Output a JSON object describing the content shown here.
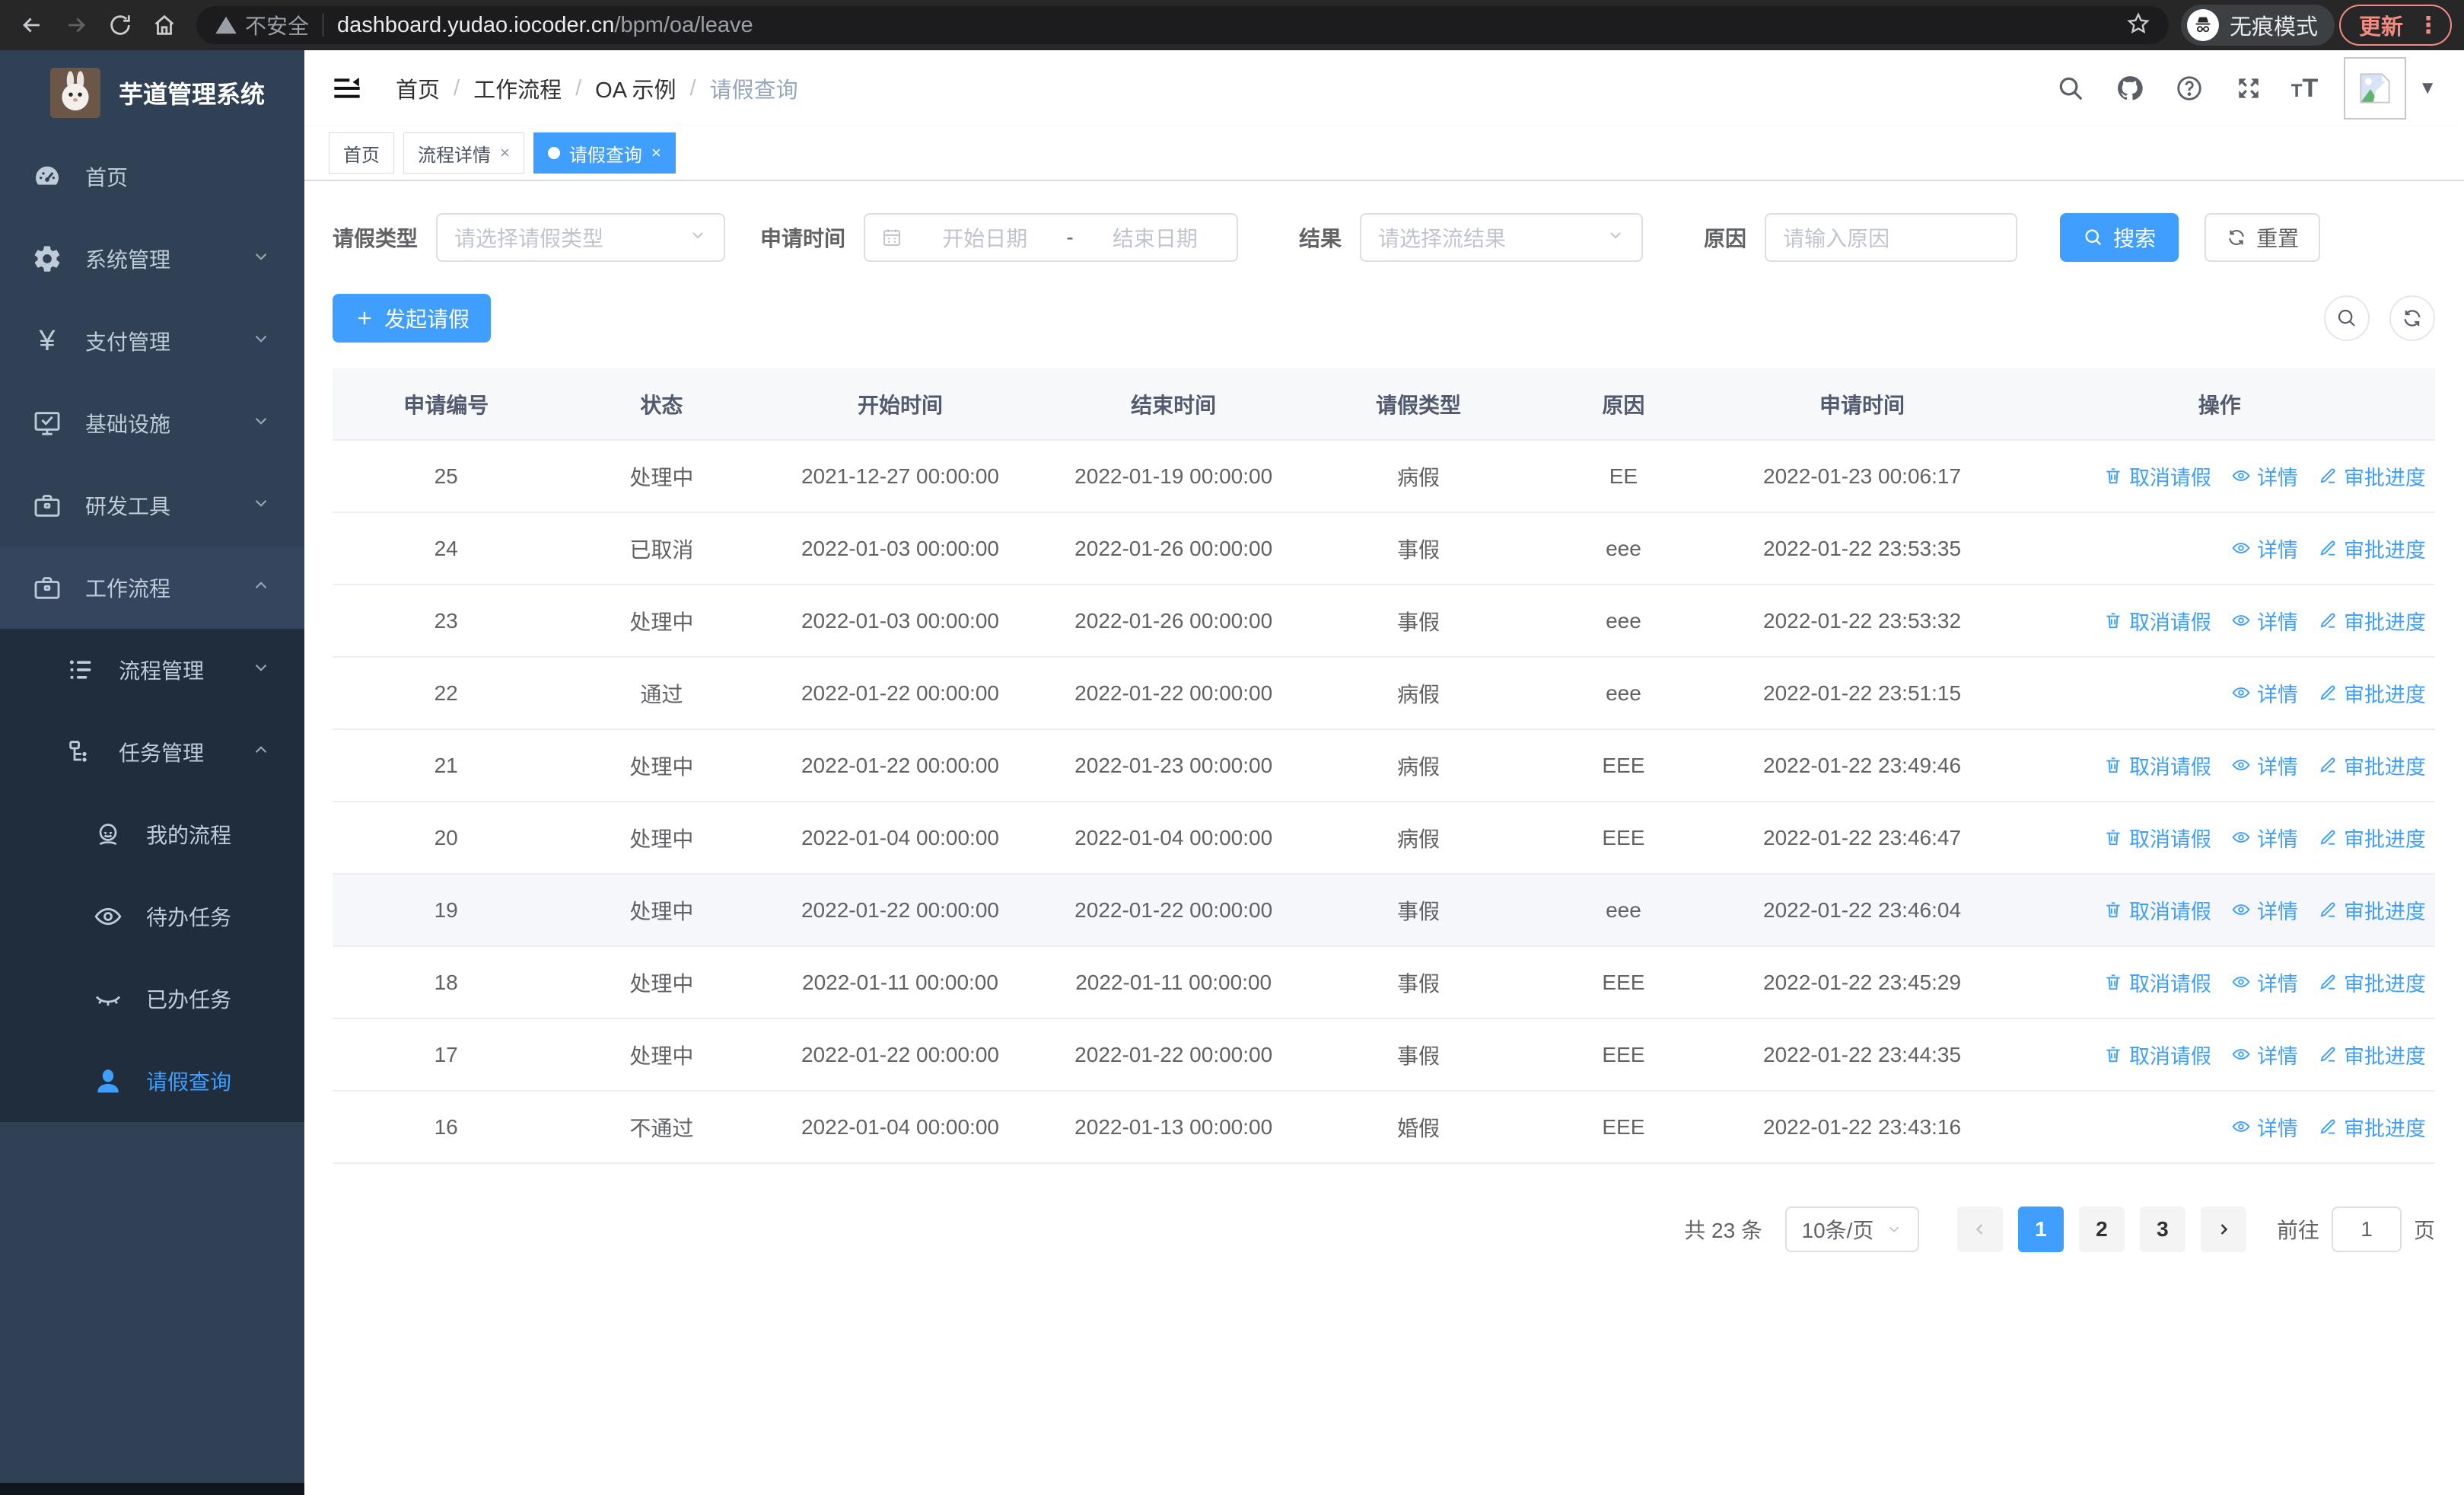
{
  "colors": {
    "accent": "#409eff",
    "update_button": "#f28b82",
    "sidebar_bg": "#304156",
    "submenu_bg": "#1f2d3d"
  },
  "browser": {
    "security_label": "不安全",
    "url_domain": "dashboard.yudao.iocoder.cn",
    "url_path": "/bpm/oa/leave",
    "incognito_label": "无痕模式",
    "update_label": "更新"
  },
  "sidebar": {
    "title": "芋道管理系统",
    "menu": [
      {
        "name": "home",
        "label": "首页",
        "icon": "dashboard-icon",
        "level": 1
      },
      {
        "name": "system",
        "label": "系统管理",
        "icon": "gear-icon",
        "level": 1,
        "chevron": "down"
      },
      {
        "name": "payment",
        "label": "支付管理",
        "icon": "yen-icon",
        "level": 1,
        "chevron": "down"
      },
      {
        "name": "infra",
        "label": "基础设施",
        "icon": "monitor-icon",
        "level": 1,
        "chevron": "down"
      },
      {
        "name": "dev-tools",
        "label": "研发工具",
        "icon": "briefcase-icon",
        "level": 1,
        "chevron": "down"
      },
      {
        "name": "workflow",
        "label": "工作流程",
        "icon": "briefcase-icon",
        "level": 1,
        "chevron": "up",
        "open": true
      },
      {
        "name": "process-mgmt",
        "label": "流程管理",
        "icon": "list-icon",
        "level": 2,
        "chevron": "down"
      },
      {
        "name": "task-mgmt",
        "label": "任务管理",
        "icon": "tree-icon",
        "level": 2,
        "chevron": "up"
      },
      {
        "name": "my-process",
        "label": "我的流程",
        "icon": "face-icon",
        "level": 3
      },
      {
        "name": "todo-task",
        "label": "待办任务",
        "icon": "eye-open-icon",
        "level": 3
      },
      {
        "name": "done-task",
        "label": "已办任务",
        "icon": "eye-closed-icon",
        "level": 3
      },
      {
        "name": "leave-query",
        "label": "请假查询",
        "icon": "user-icon",
        "level": 3,
        "active": true
      }
    ]
  },
  "breadcrumb": {
    "items": [
      "首页",
      "工作流程",
      "OA 示例",
      "请假查询"
    ],
    "separator": "/"
  },
  "tabs": [
    {
      "label": "首页",
      "closable": false,
      "active": false
    },
    {
      "label": "流程详情",
      "closable": true,
      "active": false
    },
    {
      "label": "请假查询",
      "closable": true,
      "active": true
    }
  ],
  "filters": {
    "leave_type": {
      "label": "请假类型",
      "placeholder": "请选择请假类型"
    },
    "apply_time": {
      "label": "申请时间",
      "start_placeholder": "开始日期",
      "separator": "-",
      "end_placeholder": "结束日期"
    },
    "result": {
      "label": "结果",
      "placeholder": "请选择流结果"
    },
    "reason": {
      "label": "原因",
      "placeholder": "请输入原因"
    },
    "search_label": "搜索",
    "reset_label": "重置"
  },
  "toolbar": {
    "create_label": "发起请假"
  },
  "table": {
    "columns": [
      "申请编号",
      "状态",
      "开始时间",
      "结束时间",
      "请假类型",
      "原因",
      "申请时间",
      "操作"
    ],
    "action_labels": {
      "cancel": "取消请假",
      "detail": "详情",
      "progress": "审批进度"
    },
    "rows": [
      {
        "id": "25",
        "status": "处理中",
        "start": "2021-12-27 00:00:00",
        "end": "2022-01-19 00:00:00",
        "type": "病假",
        "reason": "EE",
        "applied": "2022-01-23 00:06:17",
        "actions": [
          "cancel",
          "detail",
          "progress"
        ],
        "highlight": false
      },
      {
        "id": "24",
        "status": "已取消",
        "start": "2022-01-03 00:00:00",
        "end": "2022-01-26 00:00:00",
        "type": "事假",
        "reason": "eee",
        "applied": "2022-01-22 23:53:35",
        "actions": [
          "detail",
          "progress"
        ],
        "highlight": false
      },
      {
        "id": "23",
        "status": "处理中",
        "start": "2022-01-03 00:00:00",
        "end": "2022-01-26 00:00:00",
        "type": "事假",
        "reason": "eee",
        "applied": "2022-01-22 23:53:32",
        "actions": [
          "cancel",
          "detail",
          "progress"
        ],
        "highlight": false
      },
      {
        "id": "22",
        "status": "通过",
        "start": "2022-01-22 00:00:00",
        "end": "2022-01-22 00:00:00",
        "type": "病假",
        "reason": "eee",
        "applied": "2022-01-22 23:51:15",
        "actions": [
          "detail",
          "progress"
        ],
        "highlight": false
      },
      {
        "id": "21",
        "status": "处理中",
        "start": "2022-01-22 00:00:00",
        "end": "2022-01-23 00:00:00",
        "type": "病假",
        "reason": "EEE",
        "applied": "2022-01-22 23:49:46",
        "actions": [
          "cancel",
          "detail",
          "progress"
        ],
        "highlight": false
      },
      {
        "id": "20",
        "status": "处理中",
        "start": "2022-01-04 00:00:00",
        "end": "2022-01-04 00:00:00",
        "type": "病假",
        "reason": "EEE",
        "applied": "2022-01-22 23:46:47",
        "actions": [
          "cancel",
          "detail",
          "progress"
        ],
        "highlight": false
      },
      {
        "id": "19",
        "status": "处理中",
        "start": "2022-01-22 00:00:00",
        "end": "2022-01-22 00:00:00",
        "type": "事假",
        "reason": "eee",
        "applied": "2022-01-22 23:46:04",
        "actions": [
          "cancel",
          "detail",
          "progress"
        ],
        "highlight": true
      },
      {
        "id": "18",
        "status": "处理中",
        "start": "2022-01-11 00:00:00",
        "end": "2022-01-11 00:00:00",
        "type": "事假",
        "reason": "EEE",
        "applied": "2022-01-22 23:45:29",
        "actions": [
          "cancel",
          "detail",
          "progress"
        ],
        "highlight": false
      },
      {
        "id": "17",
        "status": "处理中",
        "start": "2022-01-22 00:00:00",
        "end": "2022-01-22 00:00:00",
        "type": "事假",
        "reason": "EEE",
        "applied": "2022-01-22 23:44:35",
        "actions": [
          "cancel",
          "detail",
          "progress"
        ],
        "highlight": false
      },
      {
        "id": "16",
        "status": "不通过",
        "start": "2022-01-04 00:00:00",
        "end": "2022-01-13 00:00:00",
        "type": "婚假",
        "reason": "EEE",
        "applied": "2022-01-22 23:43:16",
        "actions": [
          "detail",
          "progress"
        ],
        "highlight": false
      }
    ]
  },
  "pagination": {
    "total_text": "共 23 条",
    "page_size": "10条/页",
    "pages": [
      "1",
      "2",
      "3"
    ],
    "active_page": "1",
    "goto_label": "前往",
    "goto_value": "1",
    "page_unit": "页"
  }
}
